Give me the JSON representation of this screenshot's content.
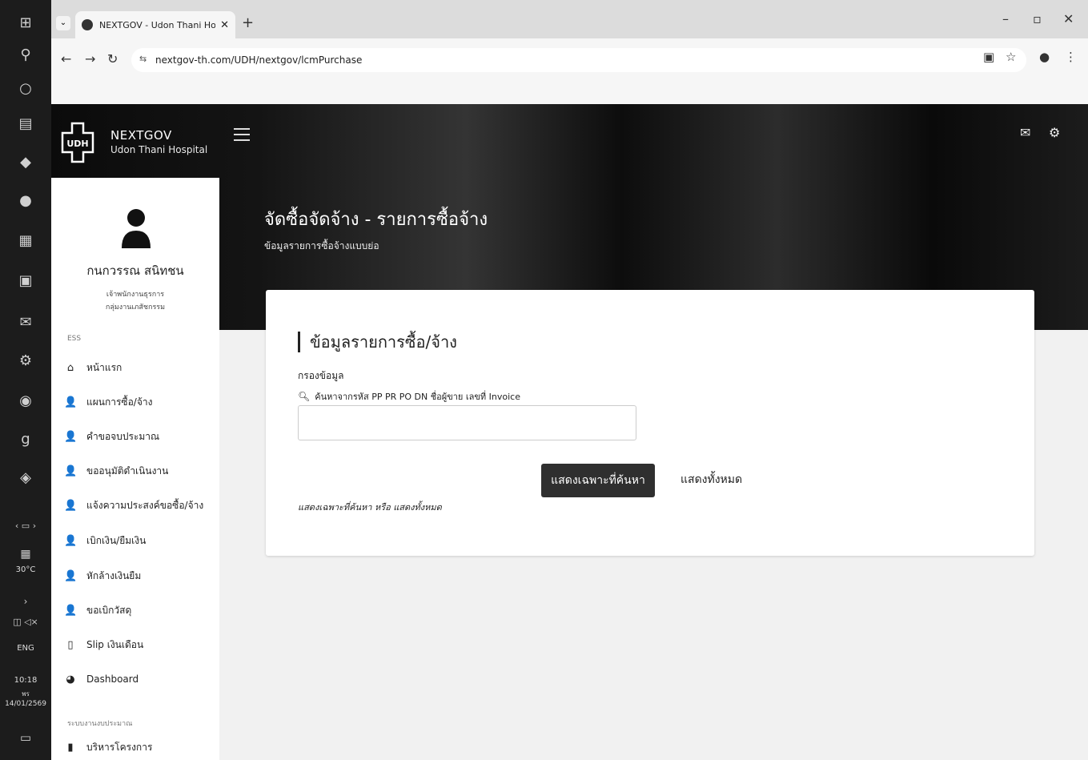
{
  "browser": {
    "tab_title": "NEXTGOV - Udon Thani Hospit",
    "url": "nextgov-th.com/UDH/nextgov/lcmPurchase"
  },
  "taskbar": {
    "weather": "30°C",
    "language": "ENG",
    "time": "10:18",
    "day": "พร",
    "date": "14/01/2569"
  },
  "app": {
    "brand_name": "NEXTGOV",
    "brand_sub": "Udon Thani Hospital",
    "logo_text": "UDH"
  },
  "user": {
    "name": "กนกวรรณ สนิทชน",
    "role": "เจ้าพนักงานธุรการ",
    "department": "กลุ่มงานเภสัชกรรม"
  },
  "sidebar": {
    "section_ess": "ESS",
    "items": [
      {
        "label": "หน้าแรก",
        "icon": "home-icon"
      },
      {
        "label": "แผนการซื้อ/จ้าง",
        "icon": "user-icon"
      },
      {
        "label": "คำขอจบประมาณ",
        "icon": "user-icon"
      },
      {
        "label": "ขออนุมัติดำเนินงาน",
        "icon": "user-icon"
      },
      {
        "label": "แจ้งความประสงค์ขอซื้อ/จ้าง",
        "icon": "user-icon"
      },
      {
        "label": "เบิกเงิน/ยืมเงิน",
        "icon": "user-icon"
      },
      {
        "label": "หักล้างเงินยืม",
        "icon": "user-icon"
      },
      {
        "label": "ขอเบิกวัสดุ",
        "icon": "user-icon"
      },
      {
        "label": "Slip เงินเดือน",
        "icon": "document-icon"
      },
      {
        "label": "Dashboard",
        "icon": "pie-chart-icon"
      }
    ],
    "section_budget": "ระบบงานงบประมาณ",
    "budget_items": [
      {
        "label": "บริหารโครงการ",
        "icon": "book-icon"
      }
    ]
  },
  "page": {
    "title": "จัดซื้อจัดจ้าง - รายการซื้อจ้าง",
    "subtitle": "ข้อมูลรายการซื้อจ้างแบบย่อ"
  },
  "card": {
    "title": "ข้อมูลรายการซื้อ/จ้าง",
    "filter_label": "กรองข้อมูล",
    "search_hint": "ค้นหาจากรหัส PP PR PO DN ชื่อผู้ขาย เลขที่ Invoice",
    "search_value": "",
    "btn_filter": "แสดงเฉพาะที่ค้นหา",
    "btn_all": "แสดงทั้งหมด",
    "note": "แสดงเฉพาะที่ค้นหา หรือ แสดงทั้งหมด"
  }
}
